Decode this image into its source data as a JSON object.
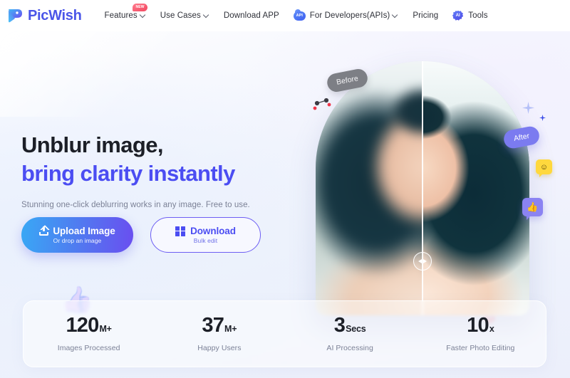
{
  "brand": {
    "name": "PicWish",
    "logo_icon": "picwish-bird-logo-icon",
    "accent": "#4b4df2"
  },
  "nav": {
    "items": [
      {
        "label": "Features",
        "has_chevron": true,
        "badge": "NEW",
        "icon": null
      },
      {
        "label": "Use Cases",
        "has_chevron": true,
        "badge": null,
        "icon": null
      },
      {
        "label": "Download APP",
        "has_chevron": false,
        "badge": null,
        "icon": null
      },
      {
        "label": "For Developers(APIs)",
        "has_chevron": true,
        "badge": null,
        "icon": "api-chip-icon",
        "icon_text": "API"
      },
      {
        "label": "Pricing",
        "has_chevron": false,
        "badge": null,
        "icon": null
      },
      {
        "label": "Tools",
        "has_chevron": false,
        "badge": null,
        "icon": "ai-tools-chip-icon",
        "icon_text": "AI"
      }
    ]
  },
  "hero": {
    "headline_line1": "Unblur image,",
    "headline_line2": "bring clarity instantly",
    "subheadline": "Stunning one-click deblurring works in any image. Free to use.",
    "upload_button": {
      "label": "Upload Image",
      "sublabel": "Or drop an image",
      "icon": "upload-icon"
    },
    "download_button": {
      "label": "Download",
      "sublabel": "Bulk edit",
      "icon": "windows-icon"
    },
    "compare": {
      "before_label": "Before",
      "after_label": "After",
      "handle_icon": "left-right-arrows-icon"
    },
    "decorations": [
      {
        "name": "sparkle-icon",
        "glyph": "✦"
      },
      {
        "name": "small-sparkle-icon",
        "glyph": "✦"
      },
      {
        "name": "pin-connector-icon",
        "glyph": ""
      },
      {
        "name": "smiley-speech-bubble-icon",
        "glyph": "☺"
      },
      {
        "name": "thumbs-up-bubble-icon",
        "glyph": "👍"
      },
      {
        "name": "thumbs-up-ghost-icon",
        "glyph": "👍"
      },
      {
        "name": "heart-ghost-icon",
        "glyph": "♥"
      }
    ]
  },
  "stats": [
    {
      "number": "120",
      "unit": "M+",
      "label": "Images Processed"
    },
    {
      "number": "37",
      "unit": "M+",
      "label": "Happy Users"
    },
    {
      "number": "3",
      "unit": "Secs",
      "label": "AI Processing"
    },
    {
      "number": "10",
      "unit": "x",
      "label": "Faster Photo Editing"
    }
  ]
}
